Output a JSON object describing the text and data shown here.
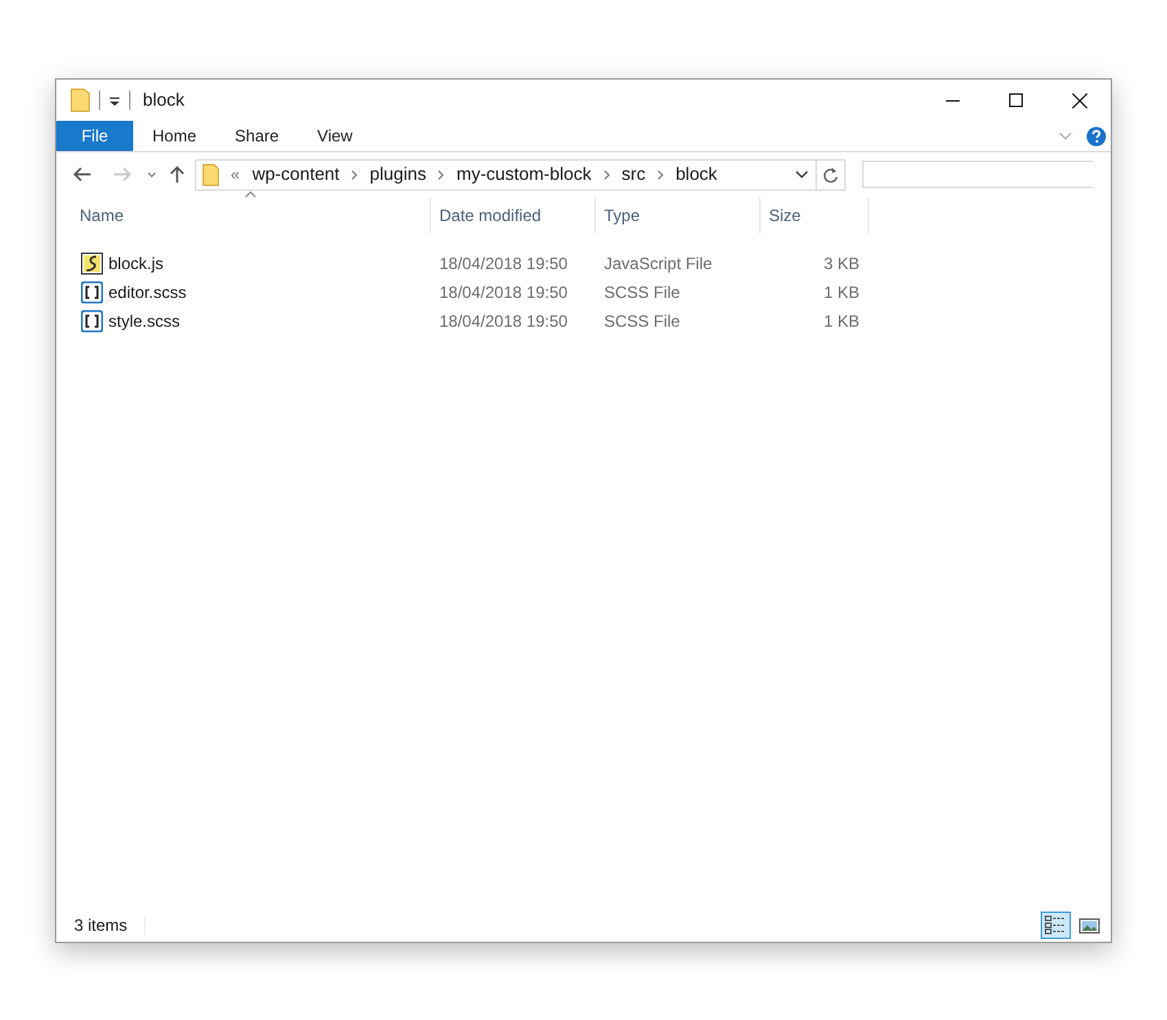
{
  "window": {
    "title": "block"
  },
  "ribbon_tabs": [
    {
      "label": "File",
      "kind": "file",
      "selected": false
    },
    {
      "label": "Home",
      "kind": "tab",
      "selected": false
    },
    {
      "label": "Share",
      "kind": "tab",
      "selected": false
    },
    {
      "label": "View",
      "kind": "tab",
      "selected": false
    }
  ],
  "address_bar": {
    "overflow": "«",
    "crumbs": [
      "wp-content",
      "plugins",
      "my-custom-block",
      "src",
      "block"
    ]
  },
  "columns": [
    "Name",
    "Date modified",
    "Type",
    "Size"
  ],
  "rows": [
    {
      "kind": "js",
      "name": "block.js",
      "date": "18/04/2018 19:50",
      "type": "JavaScript File",
      "size": "3 KB"
    },
    {
      "kind": "scss",
      "name": "editor.scss",
      "date": "18/04/2018 19:50",
      "type": "SCSS File",
      "size": "1 KB"
    },
    {
      "kind": "scss",
      "name": "style.scss",
      "date": "18/04/2018 19:50",
      "type": "SCSS File",
      "size": "1 KB"
    }
  ],
  "status_bar": {
    "text": "3 items",
    "views": [
      {
        "kind": "details",
        "selected": true
      },
      {
        "kind": "large_icons",
        "selected": false
      }
    ]
  }
}
